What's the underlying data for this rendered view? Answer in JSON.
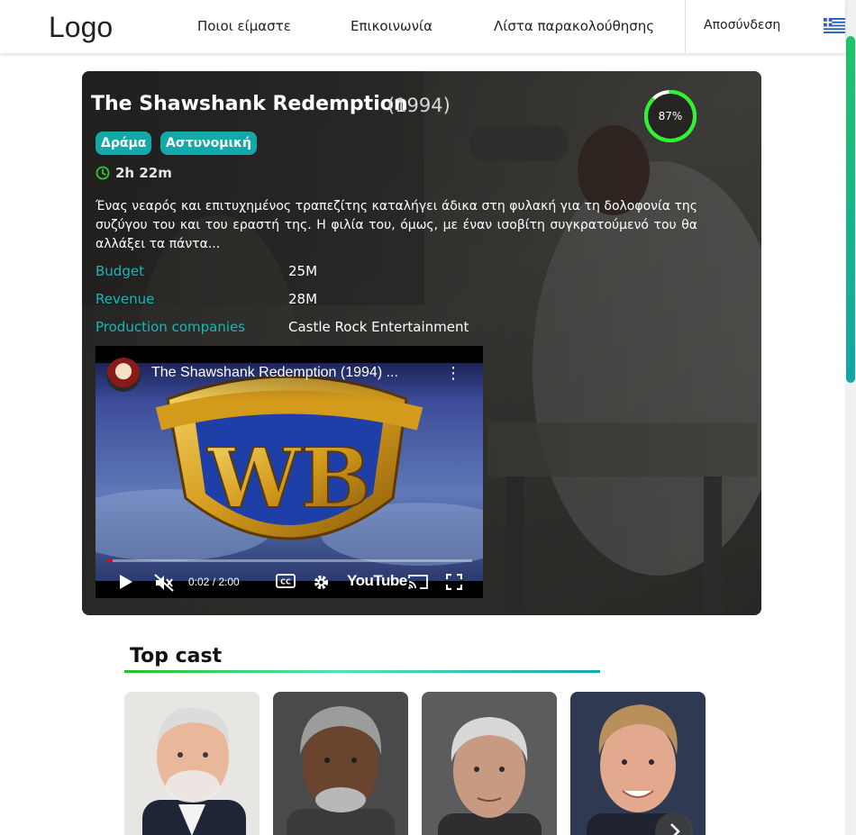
{
  "header": {
    "logo": "Logo",
    "nav": {
      "about": "Ποιοι είμαστε",
      "contact": "Επικοινωνία",
      "watchlist": "Λίστα παρακολούθησης"
    },
    "logout": "Αποσύνδεση",
    "language_flag": "greek-flag-icon"
  },
  "movie": {
    "title": "The Shawshank Redemption",
    "year": "(1994)",
    "score": {
      "label": "87%",
      "value": 0.87
    },
    "genres": [
      "Δράμα",
      "Αστυνομική"
    ],
    "runtime": "2h 22m",
    "overview": "Ένας νεαρός και επιτυχημένος τραπεζίτης καταλήγει άδικα στη φυλακή για τη δολοφονία της συζύγου του και του εραστή της. Η φιλία του, όμως, με έναν ισοβίτη συγκρατούμενό του θα αλλάξει τα πάντα...",
    "facts": [
      {
        "label": "Budget",
        "value": "25M"
      },
      {
        "label": "Revenue",
        "value": "28M"
      },
      {
        "label": "Production companies",
        "value": "Castle Rock Entertainment"
      }
    ]
  },
  "video": {
    "title": "The Shawshank Redemption (1994) ...",
    "time": "0:02 / 2:00",
    "progress": 0.017,
    "brand": "YouTube"
  },
  "cast": {
    "heading": "Top cast",
    "members": [
      {
        "icon": "cast-photo-1"
      },
      {
        "icon": "cast-photo-2"
      },
      {
        "icon": "cast-photo-3"
      },
      {
        "icon": "cast-photo-4"
      }
    ]
  },
  "colors": {
    "accent_teal": "#14a8a8",
    "score_green": "#2bf52b",
    "fact_label": "#1ab6b6"
  }
}
